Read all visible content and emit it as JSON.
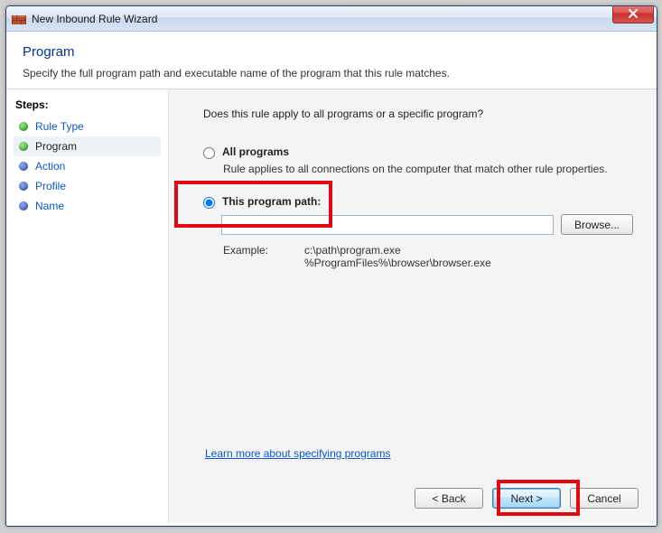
{
  "window": {
    "title": "New Inbound Rule Wizard"
  },
  "header": {
    "title": "Program",
    "subtitle": "Specify the full program path and executable name of the program that this rule matches."
  },
  "steps": {
    "label": "Steps:",
    "items": [
      {
        "label": "Rule Type",
        "state": "past"
      },
      {
        "label": "Program",
        "state": "current"
      },
      {
        "label": "Action",
        "state": "future"
      },
      {
        "label": "Profile",
        "state": "future"
      },
      {
        "label": "Name",
        "state": "future"
      }
    ]
  },
  "content": {
    "question": "Does this rule apply to all programs or a specific program?",
    "option_all": {
      "label": "All programs",
      "desc": "Rule applies to all connections on the computer that match other rule properties.",
      "checked": false
    },
    "option_path": {
      "label": "This program path:",
      "checked": true,
      "path_value": "",
      "placeholder": ""
    },
    "browse_label": "Browse...",
    "example_label": "Example:",
    "example_text": "c:\\path\\program.exe\n%ProgramFiles%\\browser\\browser.exe",
    "learn_link": "Learn more about specifying programs"
  },
  "footer": {
    "back": "< Back",
    "next": "Next >",
    "cancel": "Cancel"
  }
}
